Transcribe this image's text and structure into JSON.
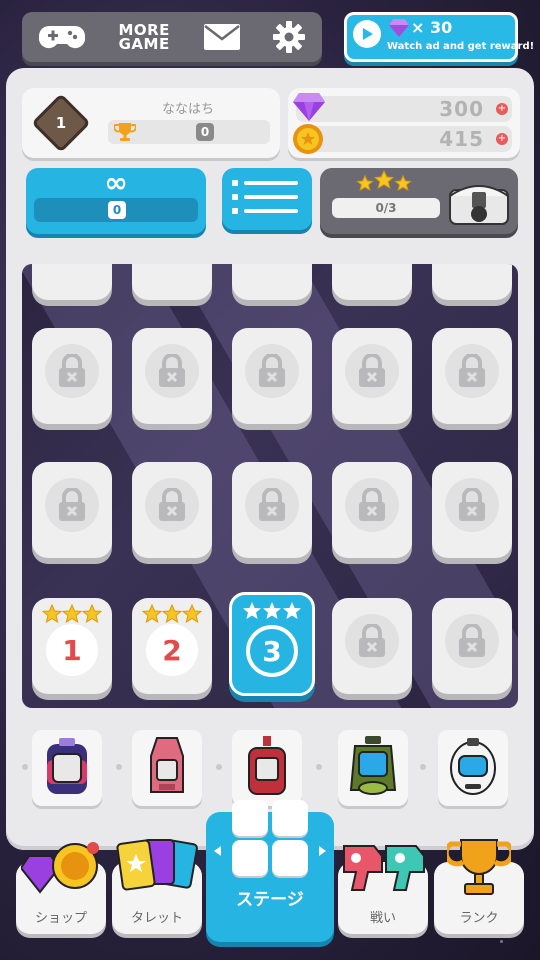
{
  "top_bar": {
    "more_game_line1": "MORE",
    "more_game_line2": "GAME",
    "icons": [
      "gamepad-icon",
      "mail-icon",
      "gear-icon"
    ]
  },
  "reward": {
    "count": "× 30",
    "label": "Watch ad and get reward!"
  },
  "player": {
    "rank": "1",
    "name": "ななはち",
    "trophies": "0"
  },
  "currency": {
    "gems": "300",
    "coins": "415"
  },
  "modes": {
    "infinite_symbol": "∞",
    "infinite_value": "0",
    "chest_progress": "0/3"
  },
  "stages": [
    {
      "number": "1",
      "stars": 3,
      "locked": false,
      "current": false
    },
    {
      "number": "2",
      "stars": 3,
      "locked": false,
      "current": false
    },
    {
      "number": "3",
      "stars": 3,
      "locked": false,
      "current": true
    }
  ],
  "nav": {
    "shop": "ショップ",
    "turret": "タレット",
    "stage": "ステージ",
    "battle": "戦い",
    "rank": "ランク"
  },
  "colors": {
    "accent": "#26b4e3",
    "dark_panel": "#6b6a72",
    "red": "#e34a4a",
    "star": "#f6c521"
  }
}
